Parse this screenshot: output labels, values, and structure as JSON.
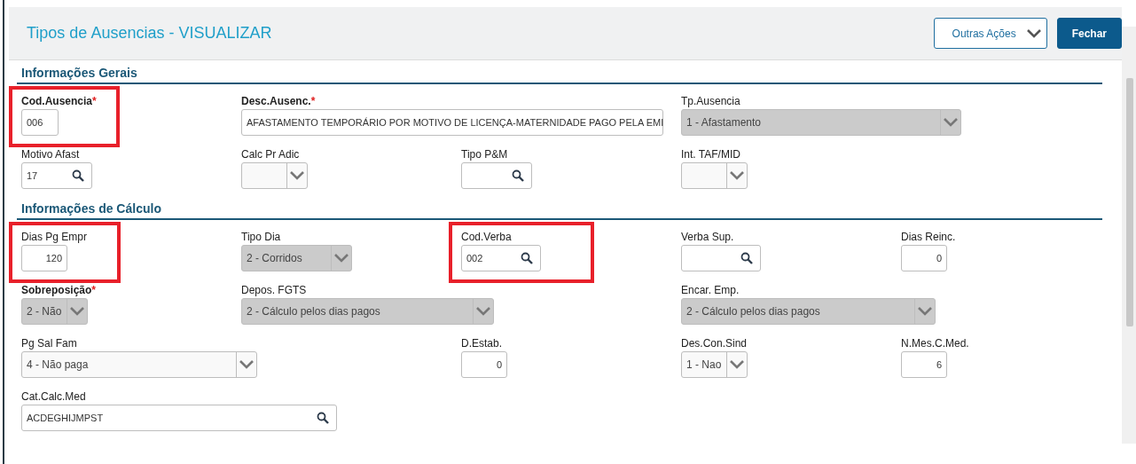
{
  "header": {
    "title": "Tipos de Ausencias - VISUALIZAR",
    "actions": [
      {
        "label": "Outras Ações",
        "kind": "menu"
      },
      {
        "label": "Fechar",
        "kind": "primary"
      }
    ]
  },
  "sections": [
    {
      "title": "Informações Gerais",
      "rows": [
        [
          {
            "label": "Cod.Ausencia",
            "required_mark": "*",
            "kind": "text",
            "value": "006",
            "disabled": false,
            "highlighted": true
          },
          {
            "label": "Desc.Ausenc.",
            "required_mark": "*",
            "kind": "text",
            "value": "AFASTAMENTO TEMPORÁRIO POR MOTIVO DE LICENÇA-MATERNIDADE PAGO PELA EMI",
            "disabled": false
          },
          "",
          {
            "label": "Tp.Ausencia",
            "kind": "select",
            "value": "1 - Afastamento",
            "disabled": true
          }
        ],
        [
          {
            "label": "Motivo Afast",
            "kind": "lookup",
            "value": "17",
            "disabled": false
          },
          {
            "label": "Calc Pr Adic",
            "kind": "select",
            "disabled": false
          },
          {
            "label": "Tipo P&M",
            "kind": "lookup",
            "disabled": false
          },
          {
            "label": "Int. TAF/MID",
            "kind": "select",
            "disabled": false
          }
        ]
      ]
    },
    {
      "title": "Informações de Cálculo",
      "rows": [
        [
          {
            "label": "Dias Pg Empr",
            "kind": "number",
            "value": "120",
            "disabled": false,
            "highlighted": true
          },
          {
            "label": "Tipo Dia",
            "kind": "select",
            "value": "2 - Corridos",
            "disabled": true
          },
          {
            "label": "Cod.Verba",
            "kind": "lookup",
            "value": "002",
            "disabled": false,
            "highlighted": true
          },
          {
            "label": "Verba Sup.",
            "kind": "lookup",
            "disabled": false
          },
          {
            "label": "Dias Reinc.",
            "kind": "number",
            "value": "0",
            "disabled": false
          }
        ],
        [
          {
            "label": "Sobreposição",
            "required_mark": "*",
            "kind": "select",
            "value": "2 - Não",
            "disabled": true
          },
          {
            "label": "Depos. FGTS",
            "kind": "select",
            "value": "2 - Cálculo pelos dias pagos",
            "disabled": true
          },
          "",
          {
            "label": "Encar. Emp.",
            "kind": "select",
            "value": "2 - Cálculo pelos dias pagos",
            "disabled": true
          }
        ],
        [
          {
            "label": "Pg Sal Fam",
            "kind": "select",
            "value": "4 - Não paga",
            "disabled": false
          },
          "",
          {
            "label": "D.Estab.",
            "kind": "number",
            "value": "0",
            "disabled": false
          },
          {
            "label": "Des.Con.Sind",
            "kind": "select",
            "value": "1 - Nao",
            "disabled": false
          },
          {
            "label": "N.Mes.C.Med.",
            "kind": "number",
            "value": "6",
            "disabled": false
          }
        ],
        [
          {
            "label": "Cat.Calc.Med",
            "kind": "lookup",
            "value": "ACDEGHIJMPST",
            "disabled": false
          }
        ]
      ]
    }
  ]
}
